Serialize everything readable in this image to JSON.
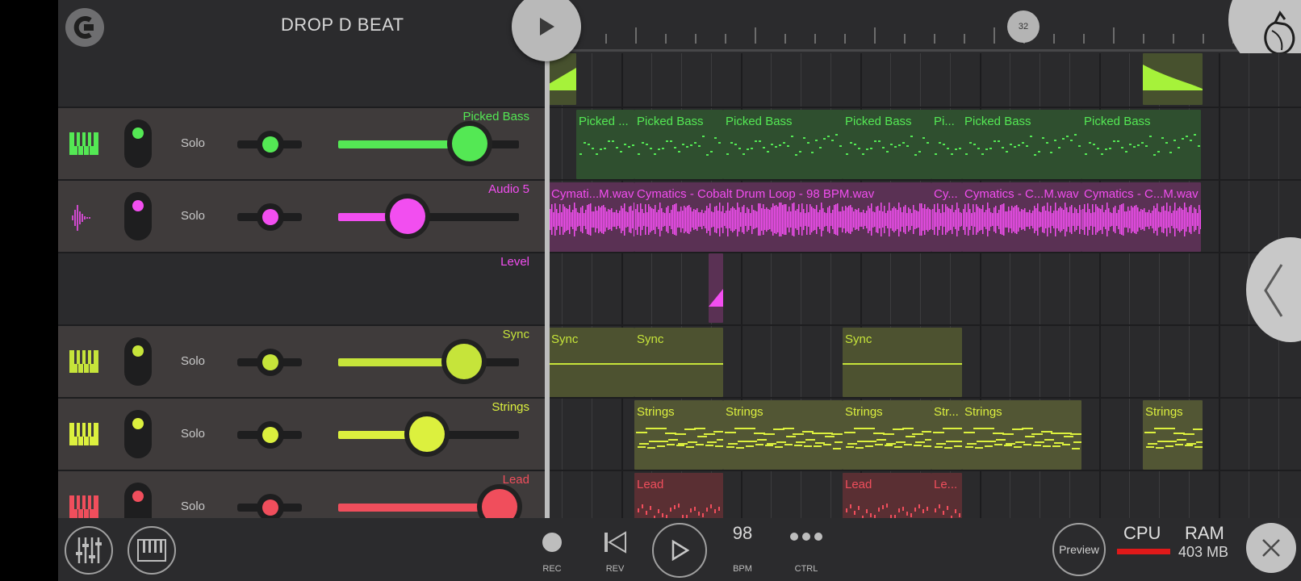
{
  "header": {
    "project_title": "DROP D BEAT",
    "position_marker": "32",
    "play_icon": "play-icon",
    "logo_icon": "undo-magnet-icon",
    "fl_icon": "fruit-logo-icon"
  },
  "colors": {
    "picked_bass": "#54e854",
    "audio5": "#f24ef0",
    "level": "#f24ef0",
    "sync": "#c6e43a",
    "strings": "#dcf03e",
    "lead": "#f04e5c",
    "background": "#2b2b2d"
  },
  "tracks": [
    {
      "name": "",
      "solo": ""
    },
    {
      "name": "Picked Bass",
      "solo": "Solo",
      "icon": "piano-icon",
      "color": "#54e854",
      "pan": 0.5,
      "volume": 0.73
    },
    {
      "name": "Audio 5",
      "solo": "Solo",
      "icon": "waveform-icon",
      "color": "#f24ef0",
      "pan": 0.5,
      "volume": 0.39
    },
    {
      "name": "Level",
      "solo": ""
    },
    {
      "name": "Sync",
      "solo": "Solo",
      "icon": "piano-icon",
      "color": "#c6e43a",
      "pan": 0.5,
      "volume": 0.71
    },
    {
      "name": "Strings",
      "solo": "Solo",
      "icon": "piano-icon",
      "color": "#dcf03e",
      "pan": 0.5,
      "volume": 0.5
    },
    {
      "name": "Lead",
      "solo": "Solo",
      "icon": "piano-icon",
      "color": "#f04e5c",
      "pan": 0.5,
      "volume": 0.9
    }
  ],
  "clips": {
    "picked_bass": [
      "Picked ...",
      "Picked Bass",
      "Picked Bass",
      "Picked Bass",
      "Pi...",
      "Picked Bass",
      "Picked Bass"
    ],
    "audio5": [
      "Cymati...M.wav",
      "Cymatics - Cobalt Drum Loop - 98 BPM.wav",
      "Cy...",
      "Cymatics - C...M.wav",
      "Cymatics - C...M.wav"
    ],
    "sync": [
      "Sync",
      "Sync",
      "Sync"
    ],
    "strings": [
      "Strings",
      "Strings",
      "Strings",
      "Str...",
      "Strings",
      "Strings"
    ],
    "lead": [
      "Lead",
      "Lead",
      "Le..."
    ]
  },
  "bottom": {
    "rec": "REC",
    "rev": "REV",
    "bpm_value": "98",
    "bpm": "BPM",
    "ctrl": "CTRL",
    "preview": "Preview",
    "cpu": "CPU",
    "ram": "RAM",
    "ram_value": "403 MB",
    "cpu_load": 1.0
  }
}
